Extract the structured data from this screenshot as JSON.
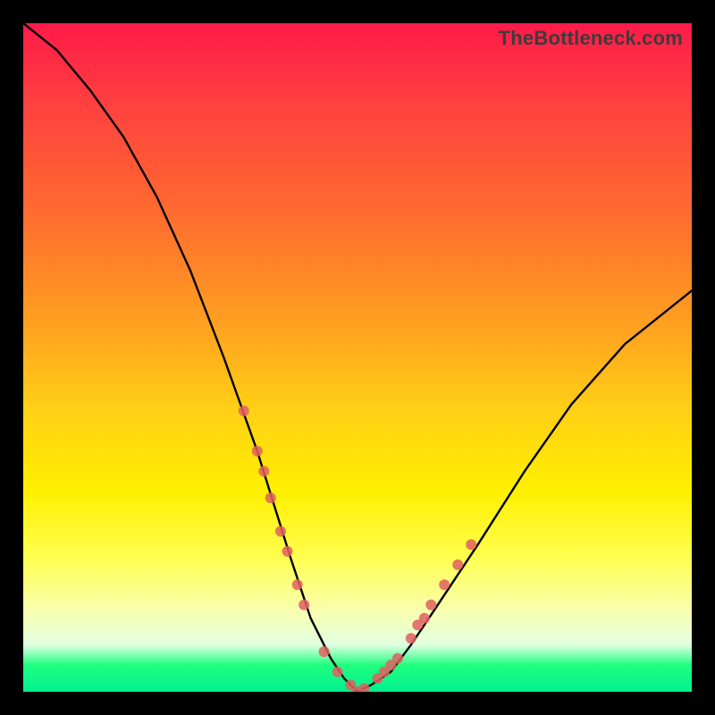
{
  "watermark": "TheBottleneck.com",
  "chart_data": {
    "type": "line",
    "title": "",
    "xlabel": "",
    "ylabel": "",
    "xlim": [
      0,
      100
    ],
    "ylim": [
      0,
      100
    ],
    "grid": false,
    "series": [
      {
        "name": "bottleneck-curve",
        "x": [
          0,
          5,
          10,
          15,
          20,
          25,
          30,
          35,
          40,
          43,
          46,
          48,
          50,
          52,
          55,
          58,
          62,
          68,
          75,
          82,
          90,
          100
        ],
        "y": [
          100,
          96,
          90,
          83,
          74,
          63,
          50,
          36,
          20,
          11,
          5,
          2,
          0,
          1,
          3,
          7,
          13,
          22,
          33,
          43,
          52,
          60
        ],
        "color": "#000000"
      }
    ],
    "markers": {
      "name": "highlight-points",
      "color": "#e06060",
      "points": [
        {
          "x": 33,
          "y": 42
        },
        {
          "x": 35,
          "y": 36
        },
        {
          "x": 36,
          "y": 33
        },
        {
          "x": 37,
          "y": 29
        },
        {
          "x": 38.5,
          "y": 24
        },
        {
          "x": 39.5,
          "y": 21
        },
        {
          "x": 41,
          "y": 16
        },
        {
          "x": 42,
          "y": 13
        },
        {
          "x": 45,
          "y": 6
        },
        {
          "x": 47,
          "y": 3
        },
        {
          "x": 49,
          "y": 1
        },
        {
          "x": 50,
          "y": 0
        },
        {
          "x": 51,
          "y": 0.5
        },
        {
          "x": 53,
          "y": 2
        },
        {
          "x": 54,
          "y": 3
        },
        {
          "x": 55,
          "y": 4
        },
        {
          "x": 56,
          "y": 5
        },
        {
          "x": 58,
          "y": 8
        },
        {
          "x": 59,
          "y": 10
        },
        {
          "x": 60,
          "y": 11
        },
        {
          "x": 61,
          "y": 13
        },
        {
          "x": 63,
          "y": 16
        },
        {
          "x": 65,
          "y": 19
        },
        {
          "x": 67,
          "y": 22
        }
      ]
    }
  }
}
